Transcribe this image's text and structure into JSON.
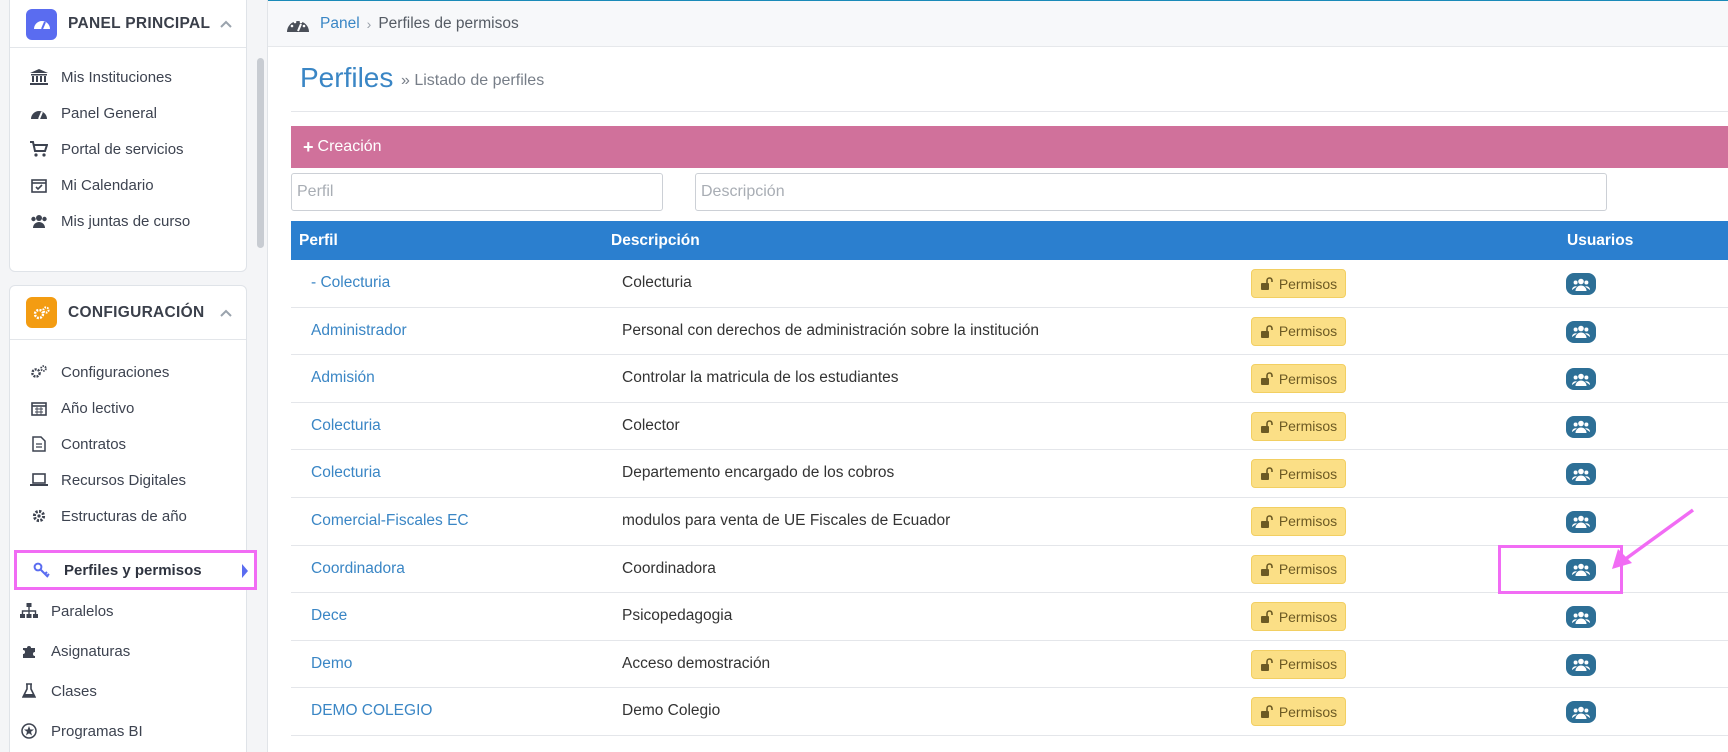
{
  "sidebar": {
    "panel_title": "PANEL PRINCIPAL",
    "panel_items": [
      {
        "label": "Mis Instituciones",
        "icon": "institution-icon"
      },
      {
        "label": "Panel General",
        "icon": "dashboard-icon"
      },
      {
        "label": "Portal de servicios",
        "icon": "cart-icon"
      },
      {
        "label": "Mi Calendario",
        "icon": "calendar-check-icon"
      },
      {
        "label": "Mis juntas de curso",
        "icon": "users-icon"
      }
    ],
    "config_title": "CONFIGURACIÓN",
    "config_items": [
      {
        "label": "Configuraciones",
        "icon": "gears-icon"
      },
      {
        "label": "Año lectivo",
        "icon": "calendar-icon"
      },
      {
        "label": "Contratos",
        "icon": "document-icon"
      },
      {
        "label": "Recursos Digitales",
        "icon": "laptop-icon"
      },
      {
        "label": "Estructuras de año",
        "icon": "gear-icon"
      },
      {
        "label": "Perfiles y permisos",
        "icon": "key-icon",
        "active": true
      },
      {
        "label": "Paralelos",
        "icon": "sitemap-icon"
      },
      {
        "label": "Asignaturas",
        "icon": "puzzle-icon"
      },
      {
        "label": "Clases",
        "icon": "flask-icon"
      },
      {
        "label": "Programas BI",
        "icon": "emblem-icon"
      }
    ]
  },
  "breadcrumb": {
    "home": "Panel",
    "separator": "›",
    "current": "Perfiles de permisos"
  },
  "page": {
    "title": "Perfiles",
    "subtitle": "» Listado de perfiles"
  },
  "creation": {
    "label": "Creación"
  },
  "form": {
    "perfil_placeholder": "Perfil",
    "descripcion_placeholder": "Descripción"
  },
  "table": {
    "headers": {
      "perfil": "Perfil",
      "descripcion": "Descripción",
      "usuarios": "Usuarios"
    },
    "permisos_label": "Permisos",
    "rows": [
      {
        "perfil": "- Colecturia",
        "descripcion": "Colecturia"
      },
      {
        "perfil": "Administrador",
        "descripcion": "Personal con derechos de administración sobre la institución"
      },
      {
        "perfil": "Admisión",
        "descripcion": "Controlar la matricula de los estudiantes"
      },
      {
        "perfil": "Colecturia",
        "descripcion": "Colector"
      },
      {
        "perfil": "Colecturia",
        "descripcion": "Departemento encargado de los cobros"
      },
      {
        "perfil": "Comercial-Fiscales EC",
        "descripcion": "modulos para venta de UE Fiscales de Ecuador"
      },
      {
        "perfil": "Coordinadora",
        "descripcion": "Coordinadora"
      },
      {
        "perfil": "Dece",
        "descripcion": "Psicopedagogia"
      },
      {
        "perfil": "Demo",
        "descripcion": "Acceso demostración"
      },
      {
        "perfil": "DEMO COLEGIO",
        "descripcion": "Demo Colegio"
      }
    ]
  },
  "colors": {
    "accent": "#3a86c5",
    "header": "#2b7fcf",
    "creation": "#d0719b",
    "highlight": "#f16cf4",
    "permisos": "#fbdf86"
  }
}
